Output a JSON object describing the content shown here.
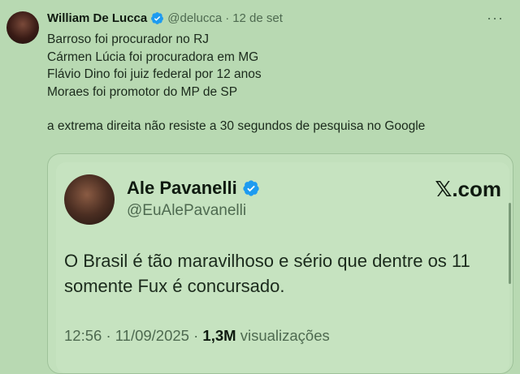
{
  "tweet": {
    "author_name": "William De Lucca",
    "author_handle": "@delucca",
    "separator": "·",
    "date": "12 de set",
    "more_label": "···",
    "lines": [
      "Barroso foi procurador no RJ",
      "Cármen Lúcia foi procuradora em MG",
      "Flávio Dino foi juiz federal por 12 anos",
      "Moraes foi promotor do MP de SP"
    ],
    "closing": "a extrema direita não resiste a 30 segundos de pesquisa no Google"
  },
  "quote": {
    "author_name": "Ale Pavanelli",
    "author_handle": "@EuAlePavanelli",
    "source_symbol": "𝕏",
    "source_domain": ".com",
    "text_lines": [
      "O Brasil é tão maravilhoso e sério que dentre os 11",
      "somente Fux é concursado."
    ],
    "time": "12:56",
    "dot": "·",
    "date": "11/09/2025",
    "dot2": "·",
    "views_count": "1,3M",
    "views_label": "visualizações"
  },
  "colors": {
    "background": "#b8d9b2",
    "verified": "#1d9bf0",
    "muted_text": "#4e6a50"
  },
  "icons": {
    "verified": "verified-badge-icon",
    "more": "more-options-icon"
  }
}
